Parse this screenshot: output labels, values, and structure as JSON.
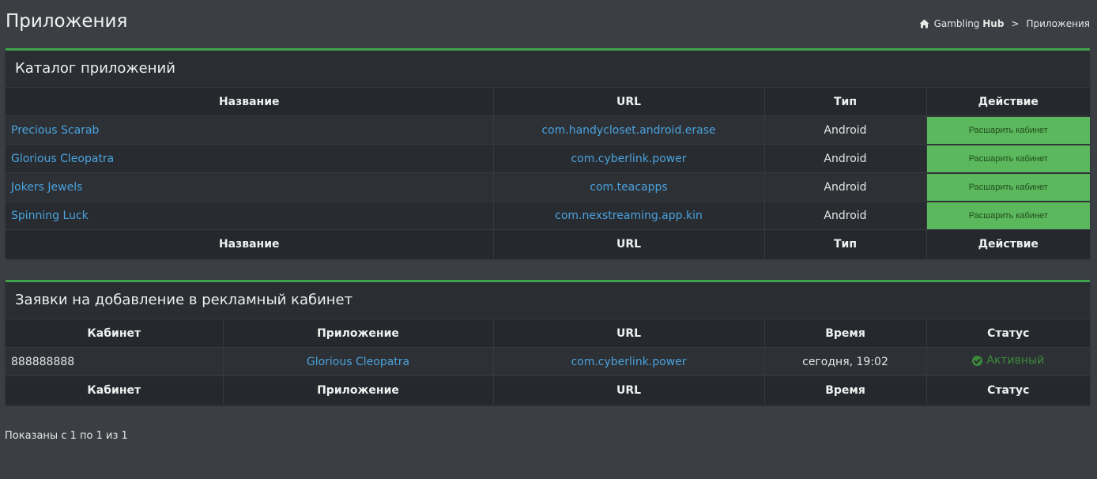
{
  "header": {
    "title": "Приложения",
    "breadcrumb": {
      "home_icon": "home-icon",
      "brand_regular": "Gambling ",
      "brand_bold": "Hub",
      "separator": ">",
      "current": "Приложения"
    }
  },
  "catalog": {
    "title": "Каталог приложений",
    "columns": [
      "Название",
      "URL",
      "Тип",
      "Действие"
    ],
    "rows": [
      {
        "name": "Precious Scarab",
        "url": "com.handycloset.android.erase",
        "type": "Android",
        "action": "Расшарить кабинет"
      },
      {
        "name": "Glorious Cleopatra",
        "url": "com.cyberlink.power",
        "type": "Android",
        "action": "Расшарить кабинет"
      },
      {
        "name": "Jokers Jewels",
        "url": "com.teacapps",
        "type": "Android",
        "action": "Расшарить кабинет"
      },
      {
        "name": "Spinning Luck",
        "url": "com.nexstreaming.app.kin",
        "type": "Android",
        "action": "Расшарить кабинет"
      }
    ]
  },
  "requests": {
    "title": "Заявки на добавление в рекламный кабинет",
    "columns": [
      "Кабинет",
      "Приложение",
      "URL",
      "Время",
      "Статус"
    ],
    "rows": [
      {
        "cabinet": "888888888",
        "app": "Glorious Cleopatra",
        "url": "com.cyberlink.power",
        "time": "сегодня, 19:02",
        "status": "Активный",
        "status_icon": "check-circle-icon"
      }
    ]
  },
  "pager": {
    "info": "Показаны с 1 по 1 из 1"
  },
  "colors": {
    "accent": "#3fa34d",
    "button": "#5cb85c",
    "link": "#4aa3df",
    "status_active": "#3c8b3c"
  }
}
